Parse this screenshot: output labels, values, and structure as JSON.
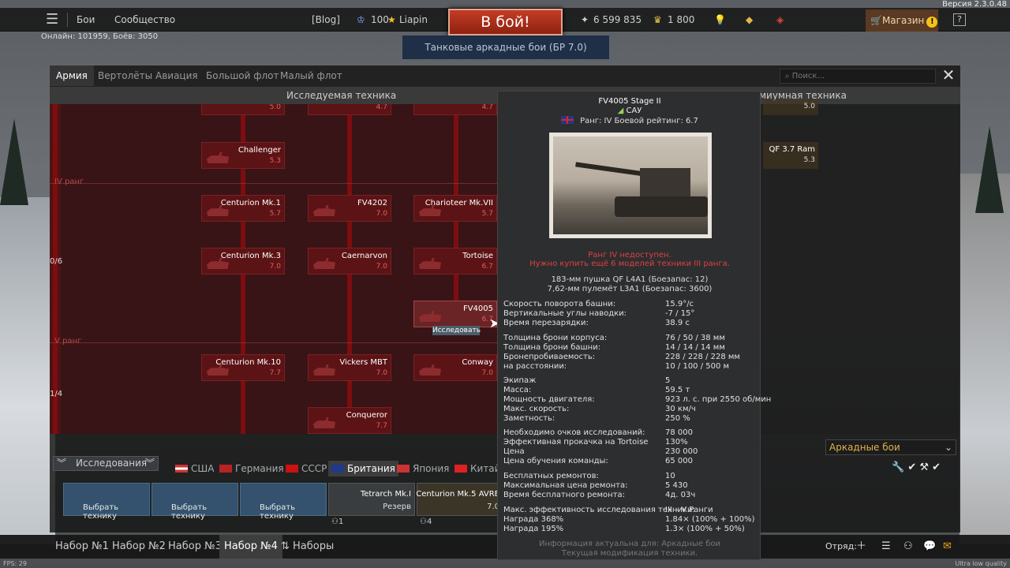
{
  "topbar": {
    "menu_icon": "hamburger-icon",
    "battles": "Бои",
    "community": "Сообщество",
    "blog": "[Blog]",
    "squad_count": "100",
    "username": "Liapin",
    "battle_button": "В бой!",
    "silver": "6 599 835",
    "gold": "1 800",
    "shop": "Магазин",
    "help": "?",
    "version": "Версия 2.3.0.48",
    "online": "Онлайн: 101959, Боёв: 3050",
    "mode": "Танковые аркадные бои (БР 7.0)"
  },
  "tabs": [
    "Армия",
    "Вертолёты",
    "Авиация",
    "Большой флот",
    "Малый флот"
  ],
  "search_placeholder": "Поиск...",
  "subheads": {
    "left": "Исследуемая техника",
    "right": "миумная техника"
  },
  "tree": {
    "rank4": "IV ранг",
    "rank5": "V ранг",
    "frac1": "0/6",
    "frac2": "1/4",
    "research_tip": "Исследовать",
    "top_brs": [
      "5.0",
      "4.7",
      "4.7"
    ],
    "cards": {
      "challenger": {
        "name": "Challenger",
        "br": "5.3"
      },
      "centurion1": {
        "name": "Centurion Mk.1",
        "br": "5.7"
      },
      "fv4202": {
        "name": "FV4202",
        "br": "7.0"
      },
      "charioteer": {
        "name": "Charioteer Mk.VII",
        "br": "5.7"
      },
      "centurion3": {
        "name": "Centurion Mk.3",
        "br": "7.0"
      },
      "caernarvon": {
        "name": "Caernarvon",
        "br": "7.0"
      },
      "tortoise": {
        "name": "Tortoise",
        "br": "6.7"
      },
      "fv4005": {
        "name": "FV4005",
        "br": "6.7"
      },
      "centurion10": {
        "name": "Centurion Mk.10",
        "br": "7.7"
      },
      "vickers": {
        "name": "Vickers MBT",
        "br": "7.0"
      },
      "conway": {
        "name": "Conway",
        "br": "7.0"
      },
      "conqueror": {
        "name": "Conqueror",
        "br": "7.7"
      }
    },
    "right": {
      "top_br": "5.0",
      "qf": {
        "name": "QF 3.7 Ram",
        "br": "5.3"
      }
    }
  },
  "bottom": {
    "research": "Исследования",
    "nations": [
      "США",
      "Германия",
      "СССР",
      "Британия",
      "Япония",
      "Китай"
    ],
    "choose": "Выбрать технику",
    "tetrarch": {
      "name": "Tetrarch Mk.I",
      "sub": "Резерв",
      "foot": "1"
    },
    "centurion5": {
      "name": "Centurion Mk.5 AVRE",
      "sub": "7.0",
      "foot": "4"
    },
    "arcade": "Аркадные бои",
    "presets": [
      "Набор №1",
      "Набор №2",
      "Набор №3",
      "Набор №4",
      "Наборы"
    ],
    "squad": "Отряд:",
    "fps": "FPS: 29",
    "quality": "Ultra low quality"
  },
  "tooltip": {
    "title": "FV4005 Stage II",
    "class": "САУ",
    "rank": "Ранг: IV   Боевой рейтинг: 6.7",
    "unavailable1": "Ранг IV недоступен.",
    "unavailable2": "Нужно купить ещё 6 моделей техники III ранга.",
    "weapon1": "183-мм пушка QF L4A1 (Боезапас: 12)",
    "weapon2": "7,62-мм пулемёт L3A1 (Боезапас: 3600)",
    "rows": [
      [
        "Скорость поворота башни:",
        "15.9°/c"
      ],
      [
        "Вертикальные углы наводки:",
        "-7 / 15°"
      ],
      [
        "Время перезарядки:",
        "38.9 с"
      ],
      [
        "Толщина брони корпуса:",
        "76 / 50 / 38 мм"
      ],
      [
        "Толщина брони башни:",
        "14 / 14 / 14 мм"
      ],
      [
        "Бронепробиваемость:",
        "228 / 228 / 228 мм"
      ],
      [
        "на расстоянии:",
        "10 / 100 / 500 м"
      ],
      [
        "Экипаж",
        "5"
      ],
      [
        "Масса:",
        "59.5 т"
      ],
      [
        "Мощность двигателя:",
        "923 л. с. при 2550 об/мин"
      ],
      [
        "Макс. скорость:",
        "30 км/ч"
      ],
      [
        "Заметность:",
        "250 %"
      ],
      [
        "Необходимо очков исследований:",
        "78 000"
      ],
      [
        "Эффективная прокачка на Tortoise",
        "130%"
      ],
      [
        "Цена",
        "230 000"
      ],
      [
        "Цена обучения команды:",
        "65 000"
      ],
      [
        "Бесплатных ремонтов:",
        "10"
      ],
      [
        "Максимальная цена ремонта:",
        "5 430"
      ],
      [
        "Время бесплатного ремонта:",
        "4д. 03ч"
      ],
      [
        "Макс. эффективность исследования техники:",
        "III – V Ранги"
      ],
      [
        "Награда 368%",
        "1.84× (100% + 100%)"
      ],
      [
        "Награда 195%",
        "1.3× (100% + 50%)"
      ]
    ],
    "foot1": "Информация актуальна для: Аркадные бои",
    "foot2": "Текущая модификация техники."
  }
}
